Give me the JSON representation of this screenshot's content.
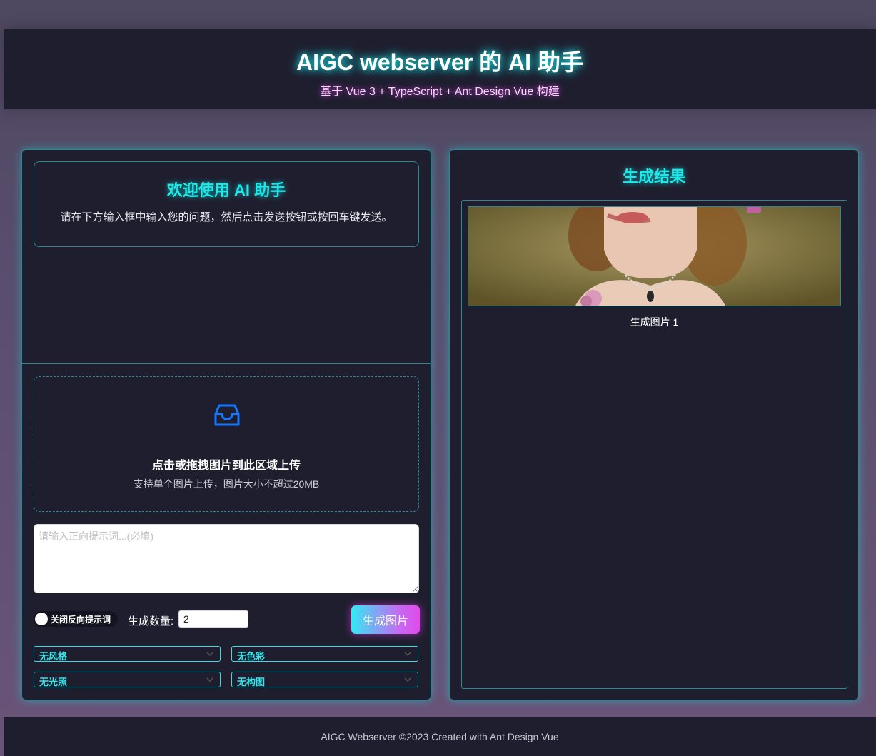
{
  "header": {
    "title": "AIGC webserver 的 AI 助手",
    "subtitle": "基于 Vue 3 + TypeScript + Ant Design Vue 构建"
  },
  "welcome": {
    "title": "欢迎使用 AI 助手",
    "text": "请在下方输入框中输入您的问题，然后点击发送按钮或按回车键发送。"
  },
  "upload": {
    "icon": "inbox-icon",
    "title": "点击或拖拽图片到此区域上传",
    "hint": "支持单个图片上传，图片大小不超过20MB"
  },
  "prompt": {
    "placeholder": "请输入正向提示词...(必填)",
    "value": ""
  },
  "controls": {
    "negative_toggle_label": "关闭反向提示词",
    "count_label": "生成数量:",
    "count_value": "2",
    "generate_label": "生成图片"
  },
  "selects": {
    "style": "无风格",
    "color": "无色彩",
    "lighting": "无光照",
    "composition": "无构图"
  },
  "result": {
    "title": "生成结果",
    "images": [
      {
        "caption": "生成图片 1"
      }
    ]
  },
  "footer": {
    "text": "AIGC Webserver ©2023 Created with Ant Design Vue"
  },
  "colors": {
    "accent_cyan": "#1de9e9",
    "accent_magenta": "#e040fb",
    "panel_bg": "#1f1e2e",
    "upload_icon": "#1677ff"
  }
}
